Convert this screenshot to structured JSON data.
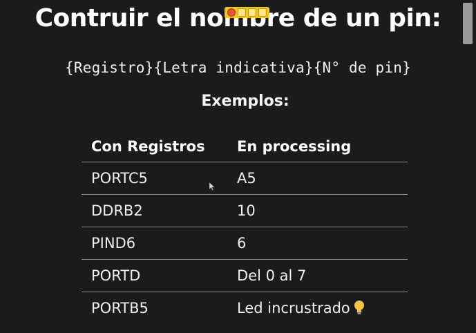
{
  "slide": {
    "title": "Contruir el nombre de un pin:",
    "formula": "{Registro}{Letra indicativa}{N° de pin}",
    "subtitle": "Exemplos:"
  },
  "table": {
    "headers": [
      "Con Registros",
      "En processing"
    ],
    "rows": [
      [
        "PORTC5",
        "A5"
      ],
      [
        "DDRB2",
        "10"
      ],
      [
        "PIND6",
        "6"
      ],
      [
        "PORTD",
        "Del 0 al 7"
      ],
      [
        "PORTB5",
        "Led incrustrado"
      ]
    ]
  },
  "icons": {
    "row5_icon": "light-bulb-icon",
    "cursor": "mouse-pointer-icon"
  },
  "colors": {
    "background": "#1b1b1b",
    "text": "#f2f2f2",
    "rule": "#8a8a8a",
    "bulb": "#f5c542"
  }
}
